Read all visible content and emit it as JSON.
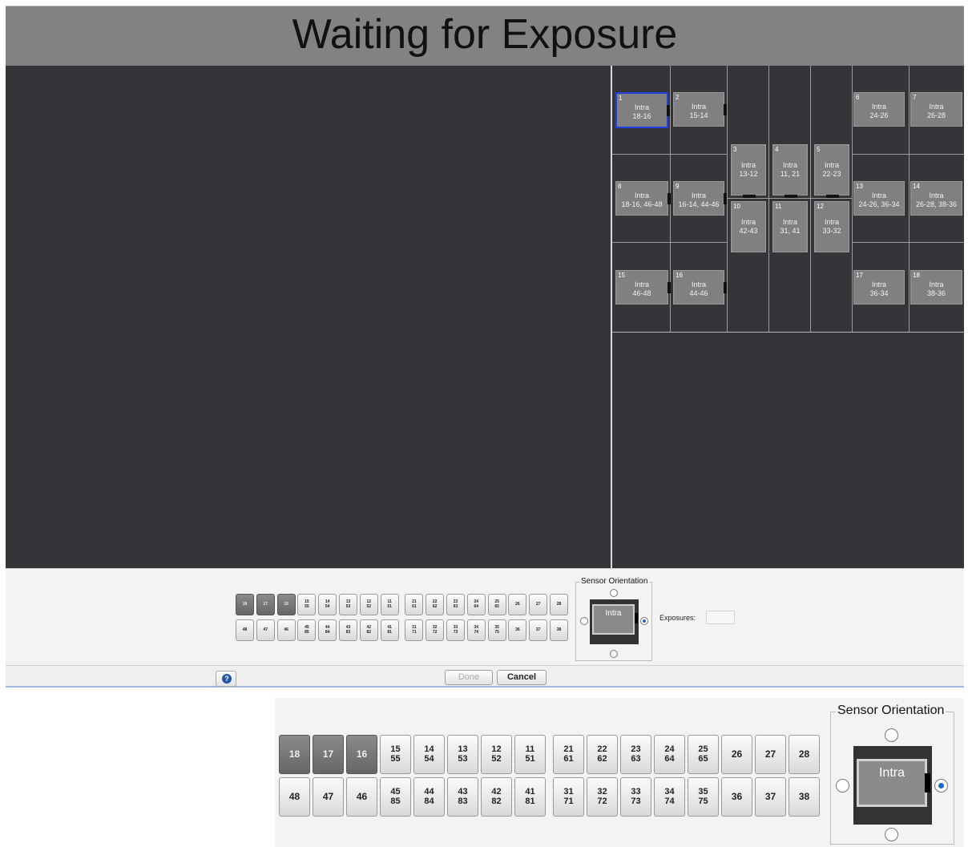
{
  "title": "Waiting for Exposure",
  "template": {
    "tiles": [
      {
        "num": "1",
        "line1": "Intra",
        "line2": "18-16"
      },
      {
        "num": "2",
        "line1": "Intra",
        "line2": "15-14"
      },
      {
        "num": "3",
        "line1": "Intra",
        "line2": "13-12"
      },
      {
        "num": "4",
        "line1": "Intra",
        "line2": "11, 21"
      },
      {
        "num": "5",
        "line1": "Intra",
        "line2": "22-23"
      },
      {
        "num": "6",
        "line1": "Intra",
        "line2": "24-26"
      },
      {
        "num": "7",
        "line1": "Intra",
        "line2": "26-28"
      },
      {
        "num": "8",
        "line1": "Intra",
        "line2": "18-16, 46-48"
      },
      {
        "num": "9",
        "line1": "Intra",
        "line2": "16-14, 44-46"
      },
      {
        "num": "10",
        "line1": "Intra",
        "line2": "42-43"
      },
      {
        "num": "11",
        "line1": "Intra",
        "line2": "31, 41"
      },
      {
        "num": "12",
        "line1": "Intra",
        "line2": "33-32"
      },
      {
        "num": "13",
        "line1": "Intra",
        "line2": "24-26, 36-34"
      },
      {
        "num": "14",
        "line1": "Intra",
        "line2": "26-28, 38-36"
      },
      {
        "num": "15",
        "line1": "Intra",
        "line2": "46-48"
      },
      {
        "num": "16",
        "line1": "Intra",
        "line2": "44-46"
      },
      {
        "num": "17",
        "line1": "Intra",
        "line2": "36-34"
      },
      {
        "num": "18",
        "line1": "Intra",
        "line2": "38-36"
      }
    ]
  },
  "teeth": {
    "upper": [
      [
        "18"
      ],
      [
        "17"
      ],
      [
        "16"
      ],
      [
        "15",
        "55"
      ],
      [
        "14",
        "54"
      ],
      [
        "13",
        "53"
      ],
      [
        "12",
        "52"
      ],
      [
        "11",
        "51"
      ],
      [
        "21",
        "61"
      ],
      [
        "22",
        "62"
      ],
      [
        "23",
        "63"
      ],
      [
        "24",
        "64"
      ],
      [
        "25",
        "65"
      ],
      [
        "26"
      ],
      [
        "27"
      ],
      [
        "28"
      ]
    ],
    "lower": [
      [
        "48"
      ],
      [
        "47"
      ],
      [
        "46"
      ],
      [
        "45",
        "85"
      ],
      [
        "44",
        "84"
      ],
      [
        "43",
        "83"
      ],
      [
        "42",
        "82"
      ],
      [
        "41",
        "81"
      ],
      [
        "31",
        "71"
      ],
      [
        "32",
        "72"
      ],
      [
        "33",
        "73"
      ],
      [
        "34",
        "74"
      ],
      [
        "35",
        "75"
      ],
      [
        "36"
      ],
      [
        "37"
      ],
      [
        "38"
      ]
    ],
    "selected": [
      "18",
      "17",
      "16"
    ]
  },
  "sensor": {
    "legend": "Sensor Orientation",
    "label": "Intra",
    "selected_position": "right"
  },
  "exposures": {
    "label": "Exposures:",
    "value": ""
  },
  "buttons": {
    "done": "Done",
    "cancel": "Cancel",
    "help_icon": "question-icon"
  },
  "colors": {
    "selection": "#1f3fe0",
    "radio_selected": "#1a6bc8",
    "background": "#353438",
    "header": "#828282"
  }
}
